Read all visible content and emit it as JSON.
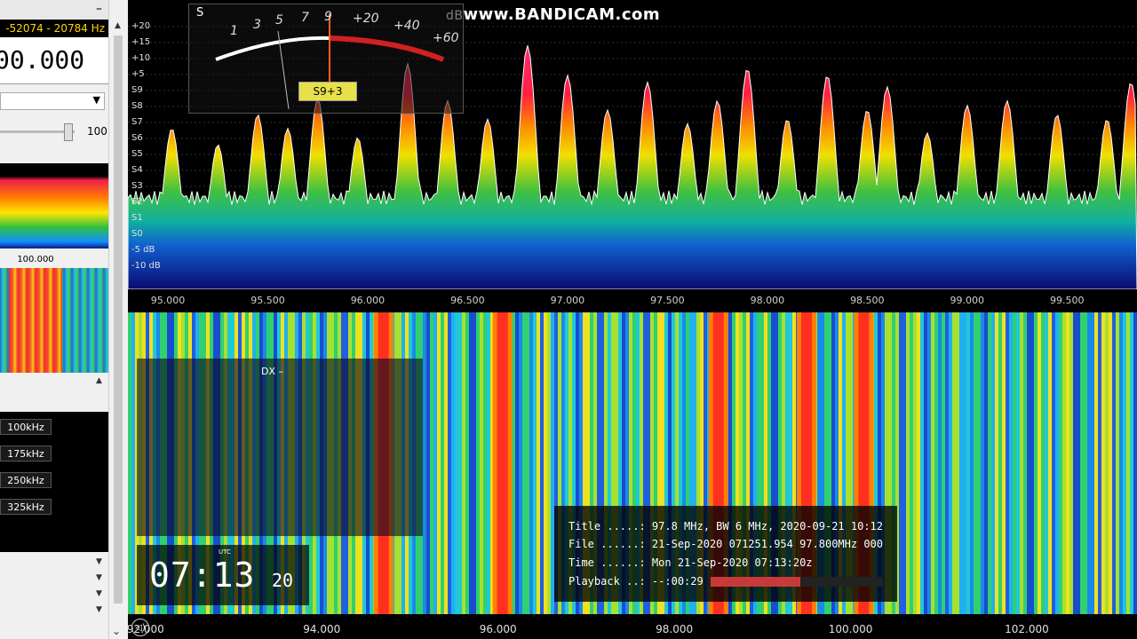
{
  "left_panel": {
    "minimize_label": "–",
    "close_label": "✕",
    "freq_range": "-52074 - 20784 Hz",
    "frequency_display": "00.000",
    "slider_value": "100",
    "mini_spectrum_label": "100.000",
    "bandwidth_buttons": [
      "100kHz",
      "175kHz",
      "250kHz",
      "325kHz"
    ]
  },
  "spectrum": {
    "watermark": "www.BANDICAM.com",
    "db_label": "dB",
    "y_labels": [
      "+20",
      "+15",
      "+10",
      "+5",
      "S9",
      "S8",
      "S7",
      "S6",
      "S5",
      "S4",
      "S3",
      "S2",
      "S1",
      "S0",
      "-5 dB",
      "-10 dB"
    ],
    "x_labels": [
      "95.000",
      "95.500",
      "96.000",
      "96.500",
      "97.000",
      "97.500",
      "98.000",
      "98.500",
      "99.000",
      "99.500"
    ],
    "x_range": [
      94.8,
      99.85
    ],
    "peaks": [
      {
        "f": 95.02,
        "h": 0.62
      },
      {
        "f": 95.25,
        "h": 0.55
      },
      {
        "f": 95.45,
        "h": 0.68
      },
      {
        "f": 95.6,
        "h": 0.62
      },
      {
        "f": 95.75,
        "h": 0.75
      },
      {
        "f": 95.95,
        "h": 0.58
      },
      {
        "f": 96.2,
        "h": 0.9
      },
      {
        "f": 96.4,
        "h": 0.74
      },
      {
        "f": 96.6,
        "h": 0.66
      },
      {
        "f": 96.8,
        "h": 0.98
      },
      {
        "f": 97.0,
        "h": 0.85
      },
      {
        "f": 97.2,
        "h": 0.7
      },
      {
        "f": 97.4,
        "h": 0.82
      },
      {
        "f": 97.6,
        "h": 0.64
      },
      {
        "f": 97.75,
        "h": 0.74
      },
      {
        "f": 97.9,
        "h": 0.88
      },
      {
        "f": 98.1,
        "h": 0.66
      },
      {
        "f": 98.3,
        "h": 0.85
      },
      {
        "f": 98.5,
        "h": 0.7
      },
      {
        "f": 98.6,
        "h": 0.8
      },
      {
        "f": 98.8,
        "h": 0.6
      },
      {
        "f": 99.0,
        "h": 0.72
      },
      {
        "f": 99.2,
        "h": 0.74
      },
      {
        "f": 99.45,
        "h": 0.68
      },
      {
        "f": 99.7,
        "h": 0.66
      },
      {
        "f": 99.82,
        "h": 0.82
      }
    ]
  },
  "meter": {
    "s_label": "S",
    "scale_labels": [
      "1",
      "3",
      "5",
      "7",
      "9",
      "+20",
      "+40",
      "+60"
    ],
    "reading": "S9+3"
  },
  "waterfall": {
    "x_labels": [
      "92.000",
      "94.000",
      "96.000",
      "98.000",
      "100.000",
      "102.000"
    ],
    "x_range": [
      91.8,
      103.25
    ],
    "hot_bands": [
      94.7,
      96.05,
      98.5,
      99.5,
      100.15
    ],
    "dx_label": "DX   –",
    "clock_time": "07:13",
    "clock_seconds": "20",
    "clock_zone": "UTC",
    "info": {
      "title": "Title .....: 97.8 MHz, BW 6 MHz, 2020-09-21 10:12",
      "file": "File ......: 21-Sep-2020 071251.954 97.800MHz 000",
      "time": "Time ......: Mon 21-Sep-2020 07:13:20z",
      "playback": "Playback ..: --:00:29"
    },
    "playback_progress": 0.52,
    "play_icon_label": "◁)"
  }
}
